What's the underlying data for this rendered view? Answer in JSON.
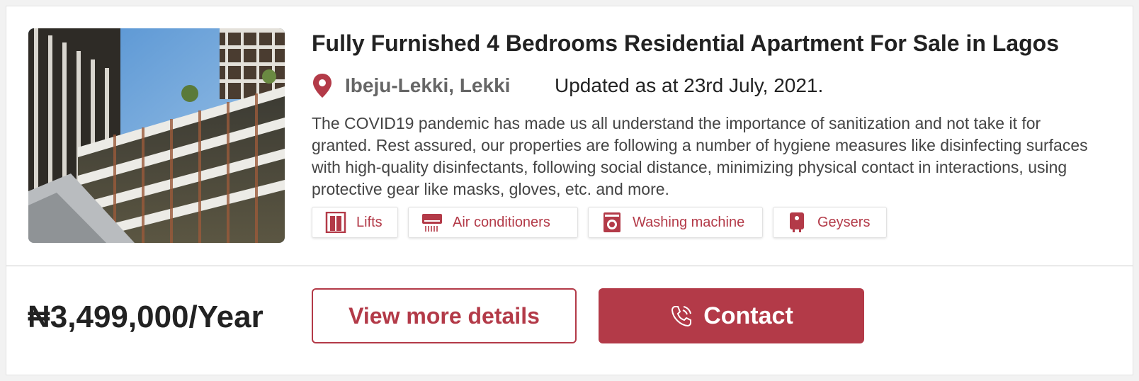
{
  "listing": {
    "title": "Fully Furnished 4 Bedrooms Residential Apartment For Sale in Lagos",
    "location": "Ibeju-Lekki, Lekki",
    "updated": "Updated as at 23rd July, 2021.",
    "description": "The COVID19 pandemic has made us all understand the importance of sanitization and not take it for granted. Rest assured, our properties are following a number of hygiene measures like disinfecting surfaces with high-quality disinfectants, following social distance, minimizing physical contact in interactions, using protective gear like masks, gloves, etc. and more.",
    "amenities": [
      {
        "label": "Lifts",
        "icon": "elevator-icon"
      },
      {
        "label": "Air conditioners",
        "icon": "air-conditioner-icon"
      },
      {
        "label": "Washing machine",
        "icon": "washing-machine-icon"
      },
      {
        "label": "Geysers",
        "icon": "water-heater-icon"
      }
    ],
    "price": "₦3,499,000/Year"
  },
  "actions": {
    "view_details_label": "View more details",
    "contact_label": "Contact"
  },
  "colors": {
    "accent": "#b33a48",
    "text": "#222222",
    "muted": "#666666"
  }
}
